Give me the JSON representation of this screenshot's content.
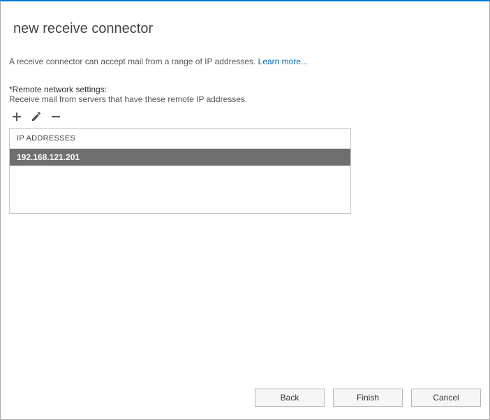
{
  "page": {
    "title": "new receive connector"
  },
  "intro": {
    "text": "A receive connector can accept mail from a range of IP addresses. ",
    "link": "Learn more..."
  },
  "section": {
    "label": "*Remote network settings:",
    "desc": "Receive mail from servers that have these remote IP addresses."
  },
  "grid": {
    "header": "IP ADDRESSES",
    "rows": [
      "192.168.121.201"
    ]
  },
  "footer": {
    "back": "Back",
    "finish": "Finish",
    "cancel": "Cancel"
  }
}
